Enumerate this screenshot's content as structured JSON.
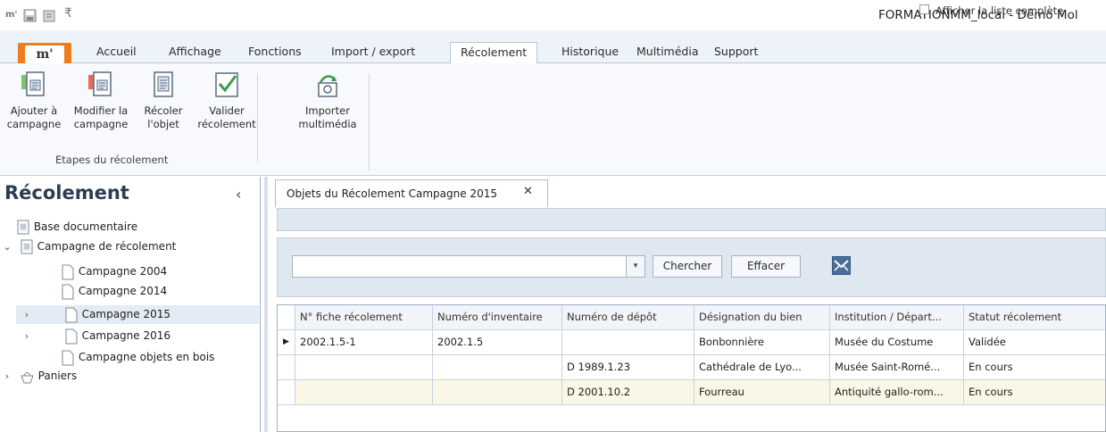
{
  "window": {
    "title": "FORMATIONMM_local - Démo Mol",
    "app_logo": "m'"
  },
  "ribbon_tabs": [
    {
      "label": "Accueil",
      "active": false
    },
    {
      "label": "Affichage",
      "active": false
    },
    {
      "label": "Fonctions",
      "active": false
    },
    {
      "label": "Import / export",
      "active": false
    },
    {
      "label": "Récolement",
      "active": true
    },
    {
      "label": "Historique",
      "active": false
    },
    {
      "label": "Multimédia",
      "active": false
    },
    {
      "label": "Support",
      "active": false
    }
  ],
  "ribbon_buttons": [
    {
      "line1": "Ajouter à",
      "line2": "campagne",
      "icon": "add-to-campaign-icon"
    },
    {
      "line1": "Modifier la",
      "line2": "campagne",
      "icon": "edit-campaign-icon"
    },
    {
      "line1": "Récoler",
      "line2": "l'objet",
      "icon": "inventory-object-icon"
    },
    {
      "line1": "Valider",
      "line2": "récolement",
      "icon": "validate-check-icon"
    },
    {
      "line1": "Importer",
      "line2": "multimédia",
      "icon": "import-multimedia-icon"
    }
  ],
  "ribbon_group_label": "Etapes du récolement",
  "left_panel": {
    "title": "Récolement",
    "collapse_glyph": "‹",
    "tree": [
      {
        "label": "Base documentaire",
        "level": 0,
        "arrow": "",
        "icon": "document-icon",
        "selected": false
      },
      {
        "label": "Campagne de récolement",
        "level": 0,
        "arrow": "expanded",
        "icon": "document-icon",
        "selected": false
      },
      {
        "label": "Campagne 2004",
        "level": 1,
        "arrow": "",
        "icon": "page-icon",
        "selected": false
      },
      {
        "label": "Campagne 2014",
        "level": 1,
        "arrow": "",
        "icon": "page-icon",
        "selected": false
      },
      {
        "label": "Campagne 2015",
        "level": 1,
        "arrow": "collapsed",
        "icon": "page-icon",
        "selected": true
      },
      {
        "label": "Campagne 2016",
        "level": 1,
        "arrow": "collapsed",
        "icon": "page-icon",
        "selected": false
      },
      {
        "label": "Campagne objets en bois",
        "level": 1,
        "arrow": "",
        "icon": "page-icon",
        "selected": false
      },
      {
        "label": "Paniers",
        "level": 0,
        "arrow": "collapsed",
        "icon": "basket-icon",
        "selected": false
      }
    ]
  },
  "document_tab": {
    "label": "Objets du Récolement Campagne 2015",
    "close_glyph": "✕"
  },
  "toolbar": {
    "full_list_label": "Afficher la liste complète",
    "full_list_checked": false,
    "search_value": "",
    "search_button": "Chercher",
    "clear_button": "Effacer"
  },
  "grid": {
    "columns": [
      "N° fiche récolement",
      "Numéro d'inventaire",
      "Numéro de dépôt",
      "Désignation du bien",
      "Institution / Départ...",
      "Statut récolement"
    ],
    "rows": [
      {
        "current": true,
        "cells": [
          "2002.1.5-1",
          "2002.1.5",
          "",
          "Bonbonnière",
          "Musée du Costume",
          "Validée"
        ]
      },
      {
        "current": false,
        "cells": [
          "",
          "",
          "D 1989.1.23",
          "Cathédrale de Lyo...",
          "Musée Saint-Romé...",
          "En cours"
        ]
      },
      {
        "current": false,
        "cells": [
          "",
          "",
          "D 2001.10.2",
          "Fourreau",
          "Antiquité gallo-rom...",
          "En cours"
        ]
      }
    ]
  },
  "colors": {
    "accent_orange": "#f07d1a",
    "ribbon_bg": "#f7f9fc",
    "panel_blue": "#dfe7f1",
    "selection": "#e3ebf5",
    "alt_row": "#fbf7e6"
  }
}
